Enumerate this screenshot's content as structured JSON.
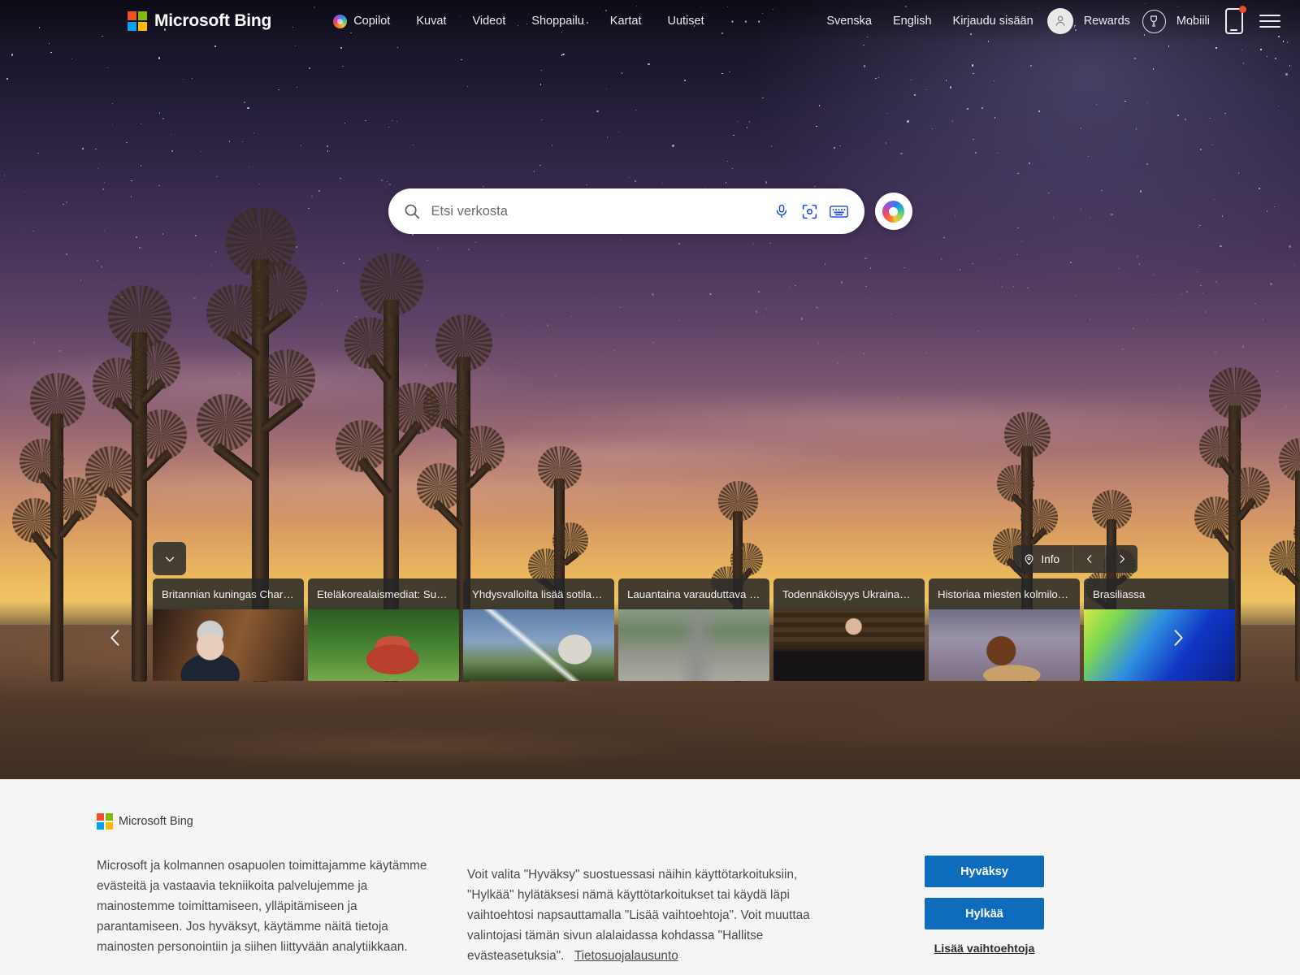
{
  "header": {
    "brand": "Microsoft Bing",
    "nav": [
      {
        "label": "Copilot",
        "icon": "copilot-icon"
      },
      {
        "label": "Kuvat",
        "icon": ""
      },
      {
        "label": "Videot",
        "icon": ""
      },
      {
        "label": "Shoppailu",
        "icon": ""
      },
      {
        "label": "Kartat",
        "icon": ""
      },
      {
        "label": "Uutiset",
        "icon": ""
      }
    ],
    "overflow": "· · ·",
    "right": [
      {
        "label": "Svenska"
      },
      {
        "label": "English"
      },
      {
        "label": "Kirjaudu sisään"
      },
      {
        "label": "Rewards"
      },
      {
        "label": "Mobiili"
      }
    ],
    "account_icon": "person-icon",
    "rewards_icon": "trophy-icon",
    "mobile_icon": "phone-icon",
    "menu_icon": "hamburger-icon"
  },
  "search": {
    "placeholder": "Etsi verkosta",
    "value": "",
    "icons": {
      "search": "search-icon",
      "mic": "microphone-icon",
      "lens": "visual-search-icon",
      "keyboard": "keyboard-icon",
      "copilot": "copilot-icon"
    }
  },
  "carousel": {
    "expand_icon": "chevron-down-icon",
    "info_label": "Info",
    "info_icon": "location-pin-icon",
    "prev_icon": "chevron-left-icon",
    "next_icon": "chevron-right-icon",
    "cards": [
      {
        "title": "Britannian kuningas Charl…",
        "thumb": "th-charles"
      },
      {
        "title": "Eteläkorealaismediat: Suo…",
        "thumb": "th-house"
      },
      {
        "title": "Yhdysvalloilta lisää sotilaa…",
        "thumb": "th-missile"
      },
      {
        "title": "Lauantaina varauduttava …",
        "thumb": "th-road"
      },
      {
        "title": "Todennäköisyys Ukrainan …",
        "thumb": "th-man"
      },
      {
        "title": "Historiaa miesten kolmiloi…",
        "thumb": "th-sport"
      },
      {
        "title": "Brasiliassa",
        "thumb": "th-brasil"
      }
    ]
  },
  "consent": {
    "brand": "Microsoft Bing",
    "paragraph_left": "Microsoft ja kolmannen osapuolen toimittajamme käytämme evästeitä ja vastaavia tekniikoita palvelujemme ja mainostemme toimittamiseen, ylläpitämiseen ja parantamiseen. Jos hyväksyt, käytämme näitä tietoja mainosten personointiin ja siihen liittyvään analytiikkaan.",
    "paragraph_mid": "Voit valita \"Hyväksy\" suostuessasi näihin käyttötarkoituksiin, \"Hylkää\" hylätäksesi nämä käyttötarkoitukset tai käydä läpi vaihtoehtosi napsauttamalla \"Lisää vaihtoehtoja\". Voit muuttaa valintojasi tämän sivun alalaidassa kohdassa \"Hallitse evästeasetuksia\".",
    "privacy_link": "Tietosuojalausunto",
    "accept_label": "Hyväksy",
    "reject_label": "Hylkää",
    "more_label": "Lisää vaihtoehtoja",
    "accent_color": "#0f6cbd",
    "background": "#f5f5f5"
  }
}
